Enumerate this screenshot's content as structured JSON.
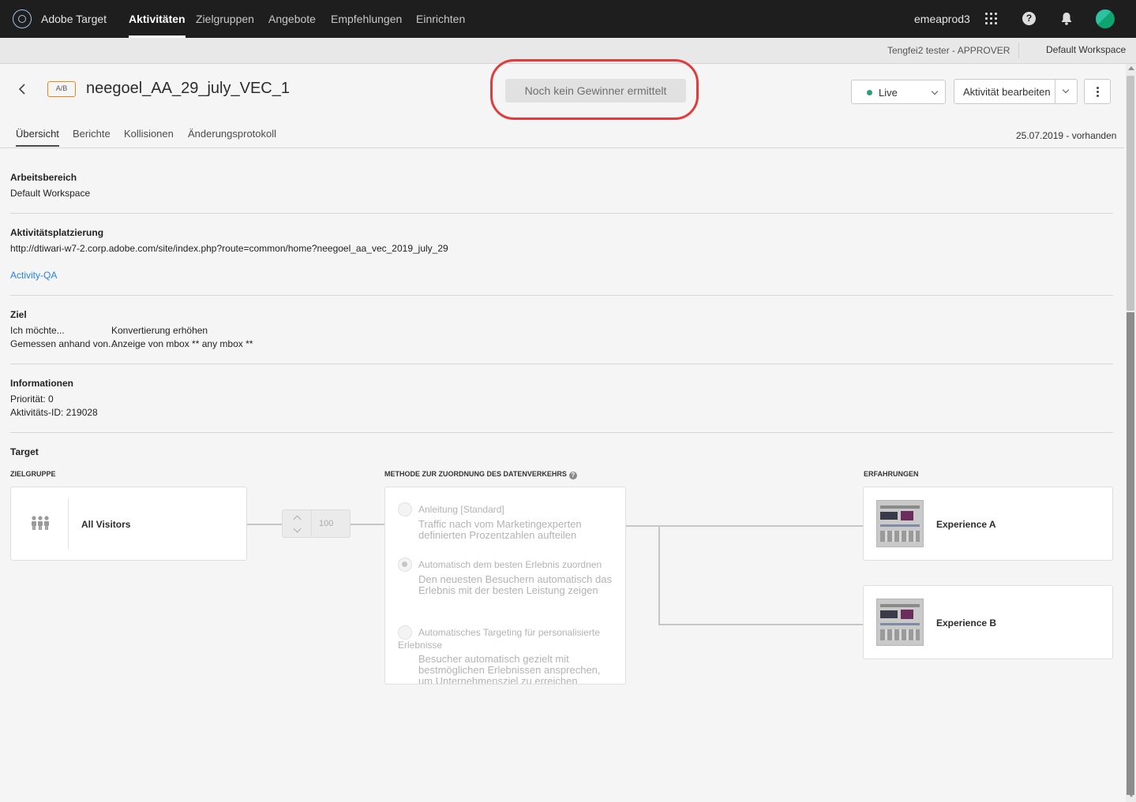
{
  "topnav": {
    "app_name": "Adobe Target",
    "items": [
      "Aktivitäten",
      "Zielgruppen",
      "Angebote",
      "Empfehlungen",
      "Einrichten"
    ],
    "org": "emeaprod3",
    "icons": [
      "apps-grid-icon",
      "help-icon",
      "bell-icon",
      "avatar"
    ]
  },
  "subbar": {
    "user_role": "Tengfei2 tester - APPROVER",
    "workspace": "Default Workspace"
  },
  "activity": {
    "badge": "A/B",
    "title": "neegoel_AA_29_july_VEC_1",
    "winner_status": "Noch kein Gewinner ermittelt",
    "live_label": "Live",
    "edit_label": "Aktivität bearbeiten"
  },
  "tabs": [
    "Übersicht",
    "Berichte",
    "Kollisionen",
    "Änderungsprotokoll"
  ],
  "date": "25.07.2019 - vorhanden",
  "sections": {
    "workspace": {
      "heading": "Arbeitsbereich",
      "value": "Default Workspace"
    },
    "placement": {
      "heading": "Aktivitätsplatzierung",
      "url": "http://dtiwari-w7-2.corp.adobe.com/site/index.php?route=common/home?neegoel_aa_vec_2019_july_29",
      "link": "Activity-QA"
    },
    "goal": {
      "heading": "Ziel",
      "rows": [
        {
          "label": "Ich möchte...",
          "value": "Konvertierung erhöhen"
        },
        {
          "label": "Gemessen anhand von...",
          "value": "Anzeige von mbox ** any mbox **"
        }
      ]
    },
    "info": {
      "heading": "Informationen",
      "priority": "Priorität: 0",
      "activity_id": "Aktivitäts-ID: 219028"
    }
  },
  "target": {
    "heading": "Target",
    "col_audience": "ZIELGRUPPE",
    "col_method": "METHODE ZUR ZUORDNUNG DES DATENVERKEHRS",
    "col_experiences": "ERFAHRUNGEN",
    "audience": "All Visitors",
    "traffic_value": "100",
    "methods": [
      {
        "title": "Anleitung [Standard]",
        "desc": "Traffic nach vom Marketingexperten definierten Prozentzahlen aufteilen",
        "selected": false
      },
      {
        "title": "Automatisch dem besten Erlebnis zuordnen",
        "desc": "Den neuesten Besuchern automatisch das Erlebnis mit der besten Leistung zeigen",
        "selected": true
      },
      {
        "title": "Automatisches Targeting für personalisierte Erlebnisse",
        "desc": "Besucher automatisch gezielt mit bestmöglichen Erlebnissen ansprechen, um Unternehmensziel zu erreichen",
        "selected": false
      }
    ],
    "experiences": [
      "Experience A",
      "Experience B"
    ]
  },
  "colors": {
    "nav_bg": "#1e1e1e",
    "highlight": "#e03c3c",
    "ab_badge": "#e68619",
    "live": "#2d9d78",
    "link": "#2680eb"
  }
}
